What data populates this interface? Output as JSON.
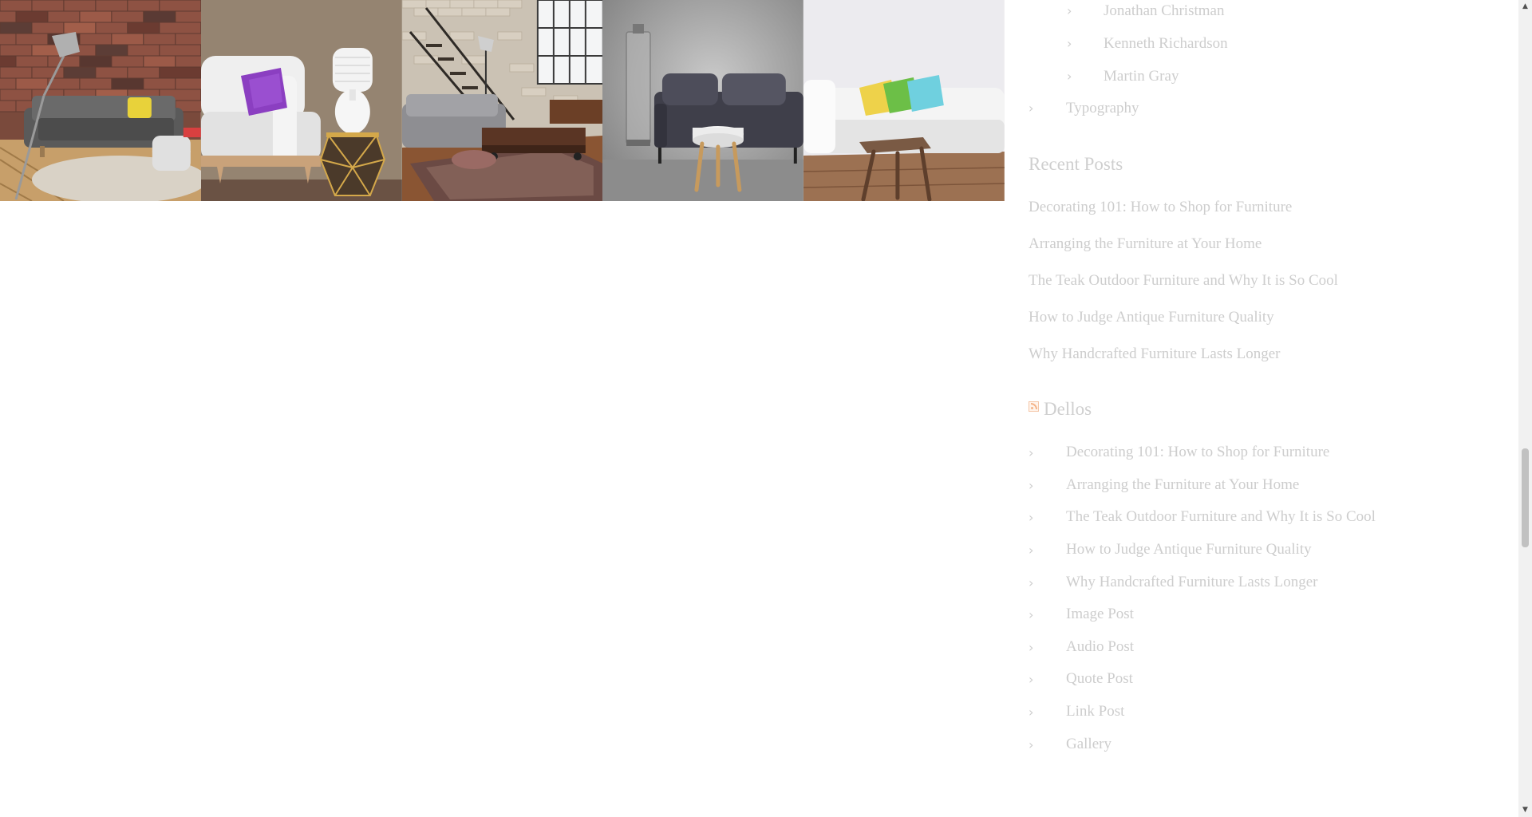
{
  "gallery": {
    "images": [
      "brick-wall-sofa-photo",
      "white-sofa-purple-pillow-photo",
      "loft-staircase-living-room-photo",
      "grey-leather-sofa-stool-photo",
      "white-sofa-colorful-pillows-photo"
    ]
  },
  "authors_list": {
    "items": [
      {
        "label": "Jonathan Christman"
      },
      {
        "label": "Kenneth Richardson"
      },
      {
        "label": "Martin Gray"
      }
    ],
    "category": "Typography"
  },
  "recent_posts": {
    "title": "Recent Posts",
    "items": [
      {
        "label": "Decorating 101: How to Shop for Furniture"
      },
      {
        "label": "Arranging the Furniture at Your Home"
      },
      {
        "label": "The Teak Outdoor Furniture and Why It is So Cool"
      },
      {
        "label": "How to Judge Antique Furniture Quality"
      },
      {
        "label": "Why Handcrafted Furniture Lasts Longer"
      }
    ]
  },
  "rss_feed": {
    "title": "Dellos",
    "icon": "rss-icon",
    "items": [
      {
        "label": "Decorating 101: How to Shop for Furniture"
      },
      {
        "label": "Arranging the Furniture at Your Home"
      },
      {
        "label": "The Teak Outdoor Furniture and Why It is So Cool"
      },
      {
        "label": "How to Judge Antique Furniture Quality"
      },
      {
        "label": "Why Handcrafted Furniture Lasts Longer"
      },
      {
        "label": "Image Post"
      },
      {
        "label": "Audio Post"
      },
      {
        "label": "Quote Post"
      },
      {
        "label": "Link Post"
      },
      {
        "label": "Gallery"
      }
    ]
  },
  "icons": {
    "chevron": "chevron-right-icon"
  },
  "colors": {
    "link": "#cdcdcd",
    "heading": "#cfcfcf"
  }
}
